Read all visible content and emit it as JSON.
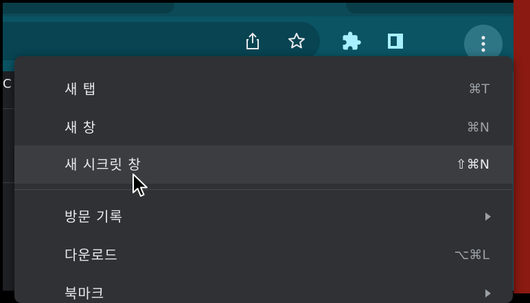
{
  "page_fragment": "C",
  "menu": {
    "items": [
      {
        "label": "새 탭",
        "shortcut": "⌘T",
        "has_submenu": false
      },
      {
        "label": "새 창",
        "shortcut": "⌘N",
        "has_submenu": false
      },
      {
        "label": "새 시크릿 창",
        "shortcut": "⇧⌘N",
        "has_submenu": false,
        "hovered": true
      },
      {
        "label": "방문 기록",
        "shortcut": "",
        "has_submenu": true
      },
      {
        "label": "다운로드",
        "shortcut": "⌥⌘L",
        "has_submenu": false
      },
      {
        "label": "북마크",
        "shortcut": "",
        "has_submenu": true
      }
    ]
  },
  "colors": {
    "tabstrip": "#0c4a57",
    "toolbar": "#0a5464",
    "menu_bg": "#303134",
    "menu_hover": "#3c3d40",
    "text": "#e8eaed",
    "accent_icon": "#a8f0ff"
  },
  "icons": [
    "share-icon",
    "star-icon",
    "extensions-icon",
    "side-panel-icon",
    "more-vert-icon",
    "submenu-arrow-icon",
    "mouse-pointer"
  ]
}
